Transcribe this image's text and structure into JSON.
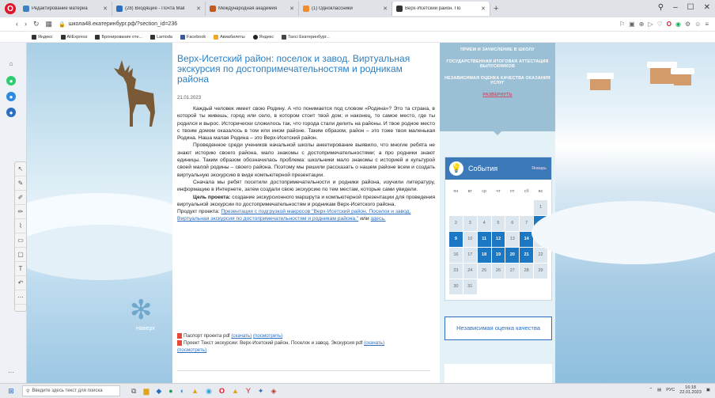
{
  "browser": {
    "tabs": [
      {
        "label": "Редактирование материа",
        "color": "#3b82c4"
      },
      {
        "label": "(28) Входящие - Почта Mail",
        "color": "#2d6ec1"
      },
      {
        "label": "Международная академия",
        "color": "#c25a1f"
      },
      {
        "label": "(1) Одноклассники",
        "color": "#f28c28"
      },
      {
        "label": "Верх-Исетский район. По",
        "color": "#333333"
      }
    ],
    "new_tab": "+",
    "url": "школа48.екатеринбург.рф/?section_id=236",
    "bookmarks": [
      "Яндекс",
      "AliExpress",
      "Бронирование оте...",
      "Lamoda",
      "Facebook",
      "Авиабилеты",
      "Яндекс",
      "Taxci Екатеринбург..."
    ]
  },
  "article": {
    "title": "Верх-Исетский район: поселок и завод. Виртуальная экскурсия по достопримечательностям и родникам района",
    "date": "21.01.2023",
    "p1": "Каждый человек имеет свою Родину. А что понимается под словом «Родина»? Это та страна, в которой ты живешь; город или село, в котором стоит твой дом; и наконец, то самое место, где ты родился и вырос. Исторически сложилось так, что города стали делить на районы. И твое родное место с твоим домом оказалось в том или ином районе. Таким образом, район – это тоже твоя маленькая Родина. Наша малая Родина – это Верх-Исетский район.",
    "p2": "Проведенное среди учеников начальной школы анкетирование выявило, что многие ребята не знают историю своего района, мало знакомы с достопримечательностями; а про родники знают единицы. Таким образом обозначилась проблема: школьники мало знакомы с историей и культурой своей малой родины – своего района. Поэтому мы решили рассказать о нашем районе всем и создать виртуальную экскурсию в виде компьютерной презентации.",
    "p3": "Сначала мы ребят посетили достопримечательности и родники района, изучили литературу, информацию в Интернете, затем создали свою экскурсию по тем местам, которые сами увидели.",
    "goal_label": "Цель проекта:",
    "goal_text": " создание экскурсионного маршрута и компьютерной презентации для проведения виртуальной экскурсии по достопримечательностям и родникам Верх-Исетского района.",
    "product_label": "Продукт проекта: ",
    "product_link": "Презентация с подгрузкой макросов \"Верх-Исетский район. Поселок и завод. Виртуальная экскурсия по достопримечательностям и родникам района.\"",
    "product_or": " или ",
    "product_here": "здесь.",
    "file1_text": "Паспорт проекта pdf ",
    "file1_download": "(скачать)",
    "file1_view": "(посмотреть)",
    "file2_text": "Проект Текст экскурсии: Верх-Исетский район. Поселок и завод. Экскурсия pdf ",
    "file2_download": "(скачать)",
    "file2_view": "(посмотреть)"
  },
  "left_panel": {
    "up_label": "Наверх"
  },
  "right_menu": {
    "items": [
      "ПРИЕМ И ЗАЧИСЛЕНИЕ В ШКОЛУ",
      "ГОСУДАРСТВЕННАЯ ИТОГОВАЯ АТТЕСТАЦИЯ ВЫПУСКНИКОВ",
      "НЕЗАВИСИМАЯ ОЦЕНКА КАЧЕСТВА ОКАЗАНИЯ УСЛУГ"
    ],
    "expand": "РАЗВЕРНУТЬ"
  },
  "events": {
    "title": "События",
    "month": "Январь",
    "weekdays": [
      "пн",
      "вт",
      "ср",
      "чт",
      "пт",
      "сб",
      "вс"
    ],
    "weeks": [
      [
        "",
        "",
        "",
        "",
        "",
        "",
        "1"
      ],
      [
        "2",
        "3",
        "4",
        "5",
        "6",
        "7",
        "8"
      ],
      [
        "9",
        "10",
        "11",
        "12",
        "13",
        "14",
        "15"
      ],
      [
        "16",
        "17",
        "18",
        "19",
        "20",
        "21",
        "22"
      ],
      [
        "23",
        "24",
        "25",
        "26",
        "27",
        "28",
        "29"
      ],
      [
        "30",
        "31",
        "",
        "",
        "",
        "",
        ""
      ]
    ],
    "highlighted": [
      "8",
      "9",
      "11",
      "12",
      "14",
      "18",
      "19",
      "20",
      "21"
    ]
  },
  "quality_button": "Независимая оценка качества",
  "taskbar": {
    "search_placeholder": "Введите здесь текст для поиска",
    "lang": "РУС",
    "time": "16:18",
    "date": "22.01.2023"
  }
}
